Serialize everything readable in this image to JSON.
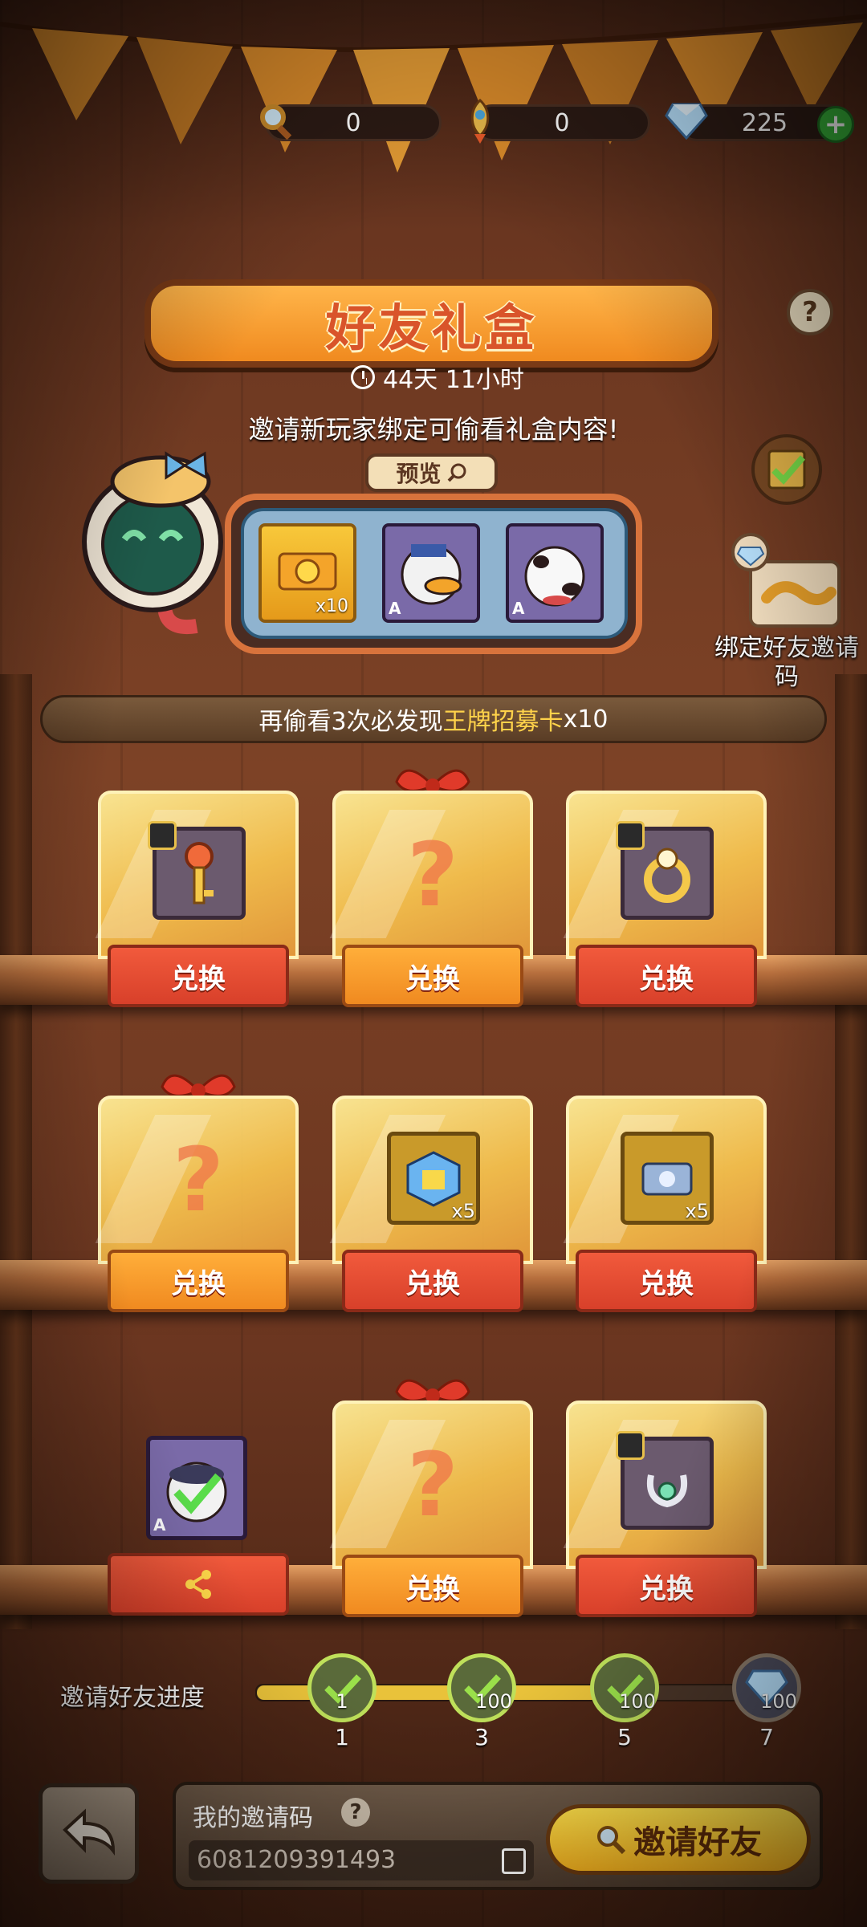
{
  "currency": {
    "magnifier": {
      "value": "0",
      "icon": "magnifier-icon"
    },
    "rocket": {
      "value": "0",
      "icon": "rocket-icon"
    },
    "gem": {
      "value": "225",
      "icon": "diamond-icon"
    }
  },
  "header": {
    "title": "好友礼盒",
    "timer": "44天 11小时",
    "invite_hint": "邀请新玩家绑定可偷看礼盒内容!",
    "preview_label": "预览"
  },
  "preview_items": [
    {
      "kind": "recruit-card",
      "count": "x10"
    },
    {
      "kind": "duck-character",
      "rank": "A"
    },
    {
      "kind": "dog-character",
      "rank": "A"
    }
  ],
  "bind": {
    "label": "绑定好友邀请码"
  },
  "peek_bar": {
    "prefix": "再偷看3次必发现",
    "highlight": "王牌招募卡",
    "suffix": " x10"
  },
  "boxes": [
    {
      "state": "revealed",
      "item": "key",
      "label": "兑换",
      "color": "red"
    },
    {
      "state": "mystery",
      "label": "兑换",
      "color": "orange"
    },
    {
      "state": "revealed",
      "item": "ring",
      "label": "兑换",
      "color": "red"
    },
    {
      "state": "mystery",
      "label": "兑换",
      "color": "orange"
    },
    {
      "state": "revealed",
      "item": "cube",
      "count": "x5",
      "label": "兑换",
      "color": "red"
    },
    {
      "state": "revealed",
      "item": "ticket",
      "count": "x5",
      "label": "兑换",
      "color": "red"
    },
    {
      "state": "claimed",
      "item": "bear-character",
      "rank": "A",
      "label": "share",
      "color": "red"
    },
    {
      "state": "mystery",
      "label": "兑换",
      "color": "orange"
    },
    {
      "state": "revealed",
      "item": "earring",
      "label": "兑换",
      "color": "red"
    }
  ],
  "progress": {
    "label": "邀请好友进度",
    "fill_fraction": 0.72,
    "nodes": [
      {
        "num": "1",
        "amount": "1",
        "done": true
      },
      {
        "num": "3",
        "amount": "100",
        "done": true
      },
      {
        "num": "5",
        "amount": "100",
        "done": true
      },
      {
        "num": "7",
        "amount": "100",
        "done": false
      }
    ]
  },
  "footer": {
    "code_title": "我的邀请码",
    "code_value": "6081209391493",
    "invite_button": "邀请好友"
  },
  "colors": {
    "accent": "#f5b21e",
    "box_red": "#e04a30",
    "box_orange": "#f59a2a",
    "highlight": "#ffd24a"
  }
}
